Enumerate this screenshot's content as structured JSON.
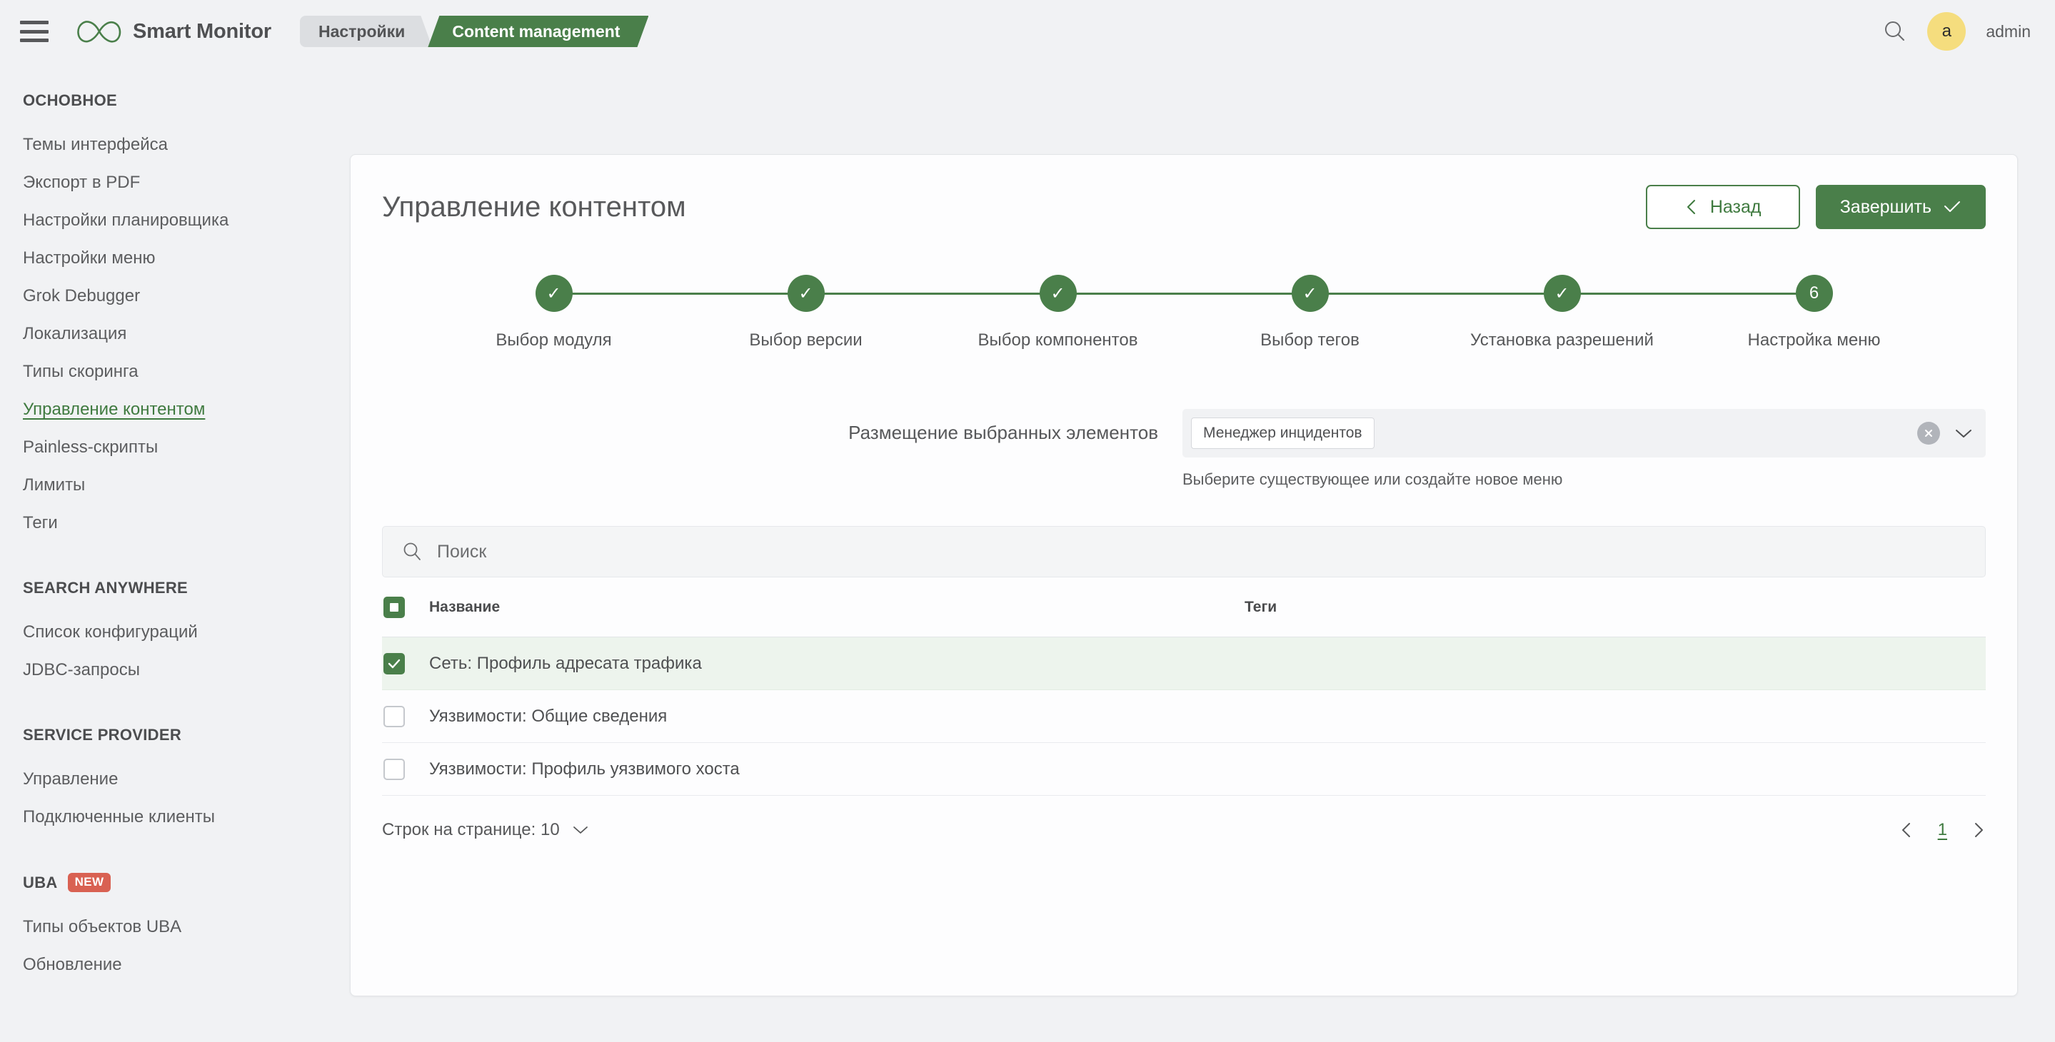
{
  "topbar": {
    "menu_icon": "hamburger-icon",
    "logo_icon": "infinity-logo-icon",
    "brand": "Smart Monitor",
    "crumbs": [
      {
        "label": "Настройки",
        "active": false
      },
      {
        "label": "Content management",
        "active": true
      }
    ],
    "search_icon": "search-icon",
    "avatar_letter": "a",
    "username": "admin",
    "avatar_color": "#f5dd7e",
    "accent_color": "#4a7f4a"
  },
  "sidebar": {
    "groups": [
      {
        "title": "ОСНОВНОЕ",
        "badge": "",
        "items": [
          {
            "label": "Темы интерфейса",
            "active": false
          },
          {
            "label": "Экспорт в PDF",
            "active": false
          },
          {
            "label": "Настройки планировщика",
            "active": false
          },
          {
            "label": "Настройки меню",
            "active": false
          },
          {
            "label": "Grok Debugger",
            "active": false
          },
          {
            "label": "Локализация",
            "active": false
          },
          {
            "label": "Типы скоринга",
            "active": false
          },
          {
            "label": "Управление контентом",
            "active": true
          },
          {
            "label": "Painless-скрипты",
            "active": false
          },
          {
            "label": "Лимиты",
            "active": false
          },
          {
            "label": "Теги",
            "active": false
          }
        ]
      },
      {
        "title": "SEARCH ANYWHERE",
        "badge": "",
        "items": [
          {
            "label": "Список конфигураций",
            "active": false
          },
          {
            "label": "JDBC-запросы",
            "active": false
          }
        ]
      },
      {
        "title": "SERVICE PROVIDER",
        "badge": "",
        "items": [
          {
            "label": "Управление",
            "active": false
          },
          {
            "label": "Подключенные клиенты",
            "active": false
          }
        ]
      },
      {
        "title": "UBA",
        "badge": "NEW",
        "items": [
          {
            "label": "Типы объектов UBA",
            "active": false
          },
          {
            "label": "Обновление",
            "active": false
          }
        ]
      }
    ]
  },
  "card": {
    "title": "Управление контентом",
    "back_button": "Назад",
    "finish_button": "Завершить",
    "stepper": {
      "current_step": 6,
      "steps": [
        {
          "label": "Выбор модуля",
          "state": "done",
          "marker": "✓"
        },
        {
          "label": "Выбор версии",
          "state": "done",
          "marker": "✓"
        },
        {
          "label": "Выбор компонентов",
          "state": "done",
          "marker": "✓"
        },
        {
          "label": "Выбор тегов",
          "state": "done",
          "marker": "✓"
        },
        {
          "label": "Установка разрешений",
          "state": "done",
          "marker": "✓"
        },
        {
          "label": "Настройка меню",
          "state": "current",
          "marker": "6"
        }
      ]
    },
    "form": {
      "label": "Размещение выбранных элементов",
      "selected_chip": "Менеджер инцидентов",
      "hint": "Выберите существующее или создайте новое меню",
      "clear_icon": "clear-circle-icon",
      "chevron_icon": "chevron-down-icon"
    },
    "search": {
      "placeholder": "Поиск",
      "value": "",
      "icon": "search-icon"
    },
    "table": {
      "columns": [
        "Название",
        "Теги"
      ],
      "header_checkbox_state": "indeterminate",
      "rows": [
        {
          "name": "Сеть: Профиль адресата трафика",
          "tags": "",
          "checked": true
        },
        {
          "name": "Уязвимости: Общие сведения",
          "tags": "",
          "checked": false
        },
        {
          "name": "Уязвимости: Профиль уязвимого хоста",
          "tags": "",
          "checked": false
        }
      ]
    },
    "pagination": {
      "rows_label": "Строк на странице: 10",
      "current_page": "1",
      "prev_icon": "chevron-left-icon",
      "next_icon": "chevron-right-icon"
    }
  }
}
